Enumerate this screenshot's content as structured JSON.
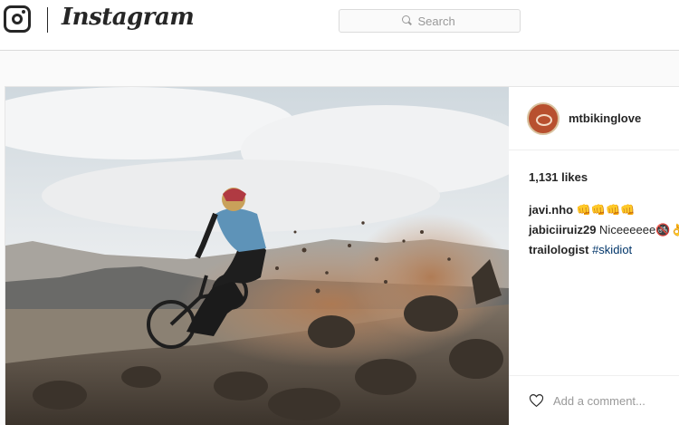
{
  "header": {
    "logo_icon": "instagram-camera-icon",
    "wordmark": "Instagram",
    "search": {
      "placeholder": "Search",
      "icon": "search-icon"
    }
  },
  "post": {
    "image_description_icon": "photo",
    "author": {
      "username": "mtbikinglove",
      "avatar_icon": "avatar"
    },
    "likes": "1,131 likes",
    "comments": [
      {
        "user": "javi.nho",
        "text": "👊👊👊👊"
      },
      {
        "user": "jabiciiruiz29",
        "text": "Niceeeeee🚳👌"
      },
      {
        "user": "trailologist",
        "text": "#skidiot"
      }
    ],
    "add_comment": {
      "placeholder": "Add a comment...",
      "like_icon": "heart-icon"
    }
  },
  "colors": {
    "link": "#003569",
    "border": "#dbdbdb",
    "background": "#fafafa"
  }
}
